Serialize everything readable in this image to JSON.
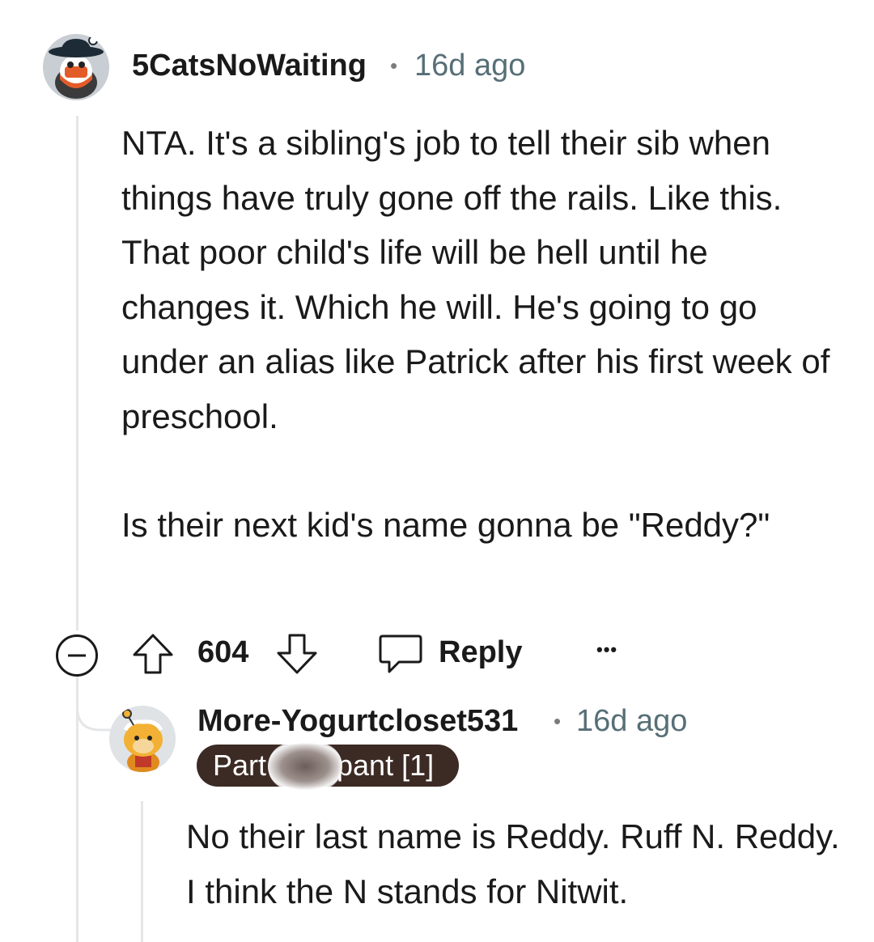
{
  "comment": {
    "username": "5CatsNoWaiting",
    "separator": "•",
    "time": "16d ago",
    "paragraphs": [
      "NTA. It's a sibling's job to tell their sib when things have truly gone off the rails. Like this. That poor child's life will be hell until he changes it. Which he will. He's going to go under an alias like Patrick after his first week of preschool.",
      "Is their next kid's name gonna be \"Reddy?\""
    ],
    "actions": {
      "collapse_icon": "minus-circle-icon",
      "upvote_icon": "upvote-arrow-icon",
      "score": "604",
      "downvote_icon": "downvote-arrow-icon",
      "reply_icon": "speech-bubble-icon",
      "reply_label": "Reply",
      "more_icon": "ellipsis-icon",
      "more_label": "•••"
    }
  },
  "reply": {
    "username": "More-Yogurtcloset531",
    "separator": "•",
    "time": "16d ago",
    "flair_left": "Part",
    "flair_right": "pant [1]",
    "paragraphs": [
      "No their last name is Reddy. Ruff N. Reddy. I think the N stands for Nitwit."
    ]
  },
  "colors": {
    "text": "#1a1a1b",
    "meta": "#576f76",
    "thread_line": "#e4e6e8",
    "flair_bg": "#3c2a24"
  }
}
